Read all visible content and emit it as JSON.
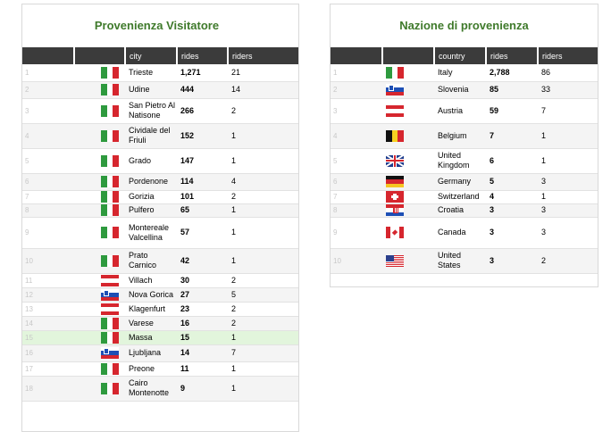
{
  "left": {
    "title": "Provenienza Visitatore",
    "columns": {
      "city": "city",
      "rides": "rides",
      "riders": "riders"
    },
    "rows": [
      {
        "n": "1",
        "flag": "italy-flag-icon",
        "country": "it",
        "city": "Trieste",
        "rides": "1,271",
        "riders": "21"
      },
      {
        "n": "2",
        "flag": "italy-flag-icon",
        "country": "it",
        "city": "Udine",
        "rides": "444",
        "riders": "14"
      },
      {
        "n": "3",
        "flag": "italy-flag-icon",
        "country": "it",
        "city": "San Pietro Al Natisone",
        "rides": "266",
        "riders": "2"
      },
      {
        "n": "4",
        "flag": "italy-flag-icon",
        "country": "it",
        "city": "Cividale del Friuli",
        "rides": "152",
        "riders": "1"
      },
      {
        "n": "5",
        "flag": "italy-flag-icon",
        "country": "it",
        "city": "Grado",
        "rides": "147",
        "riders": "1"
      },
      {
        "n": "6",
        "flag": "italy-flag-icon",
        "country": "it",
        "city": "Pordenone",
        "rides": "114",
        "riders": "4"
      },
      {
        "n": "7",
        "flag": "italy-flag-icon",
        "country": "it",
        "city": "Gorizia",
        "rides": "101",
        "riders": "2"
      },
      {
        "n": "8",
        "flag": "italy-flag-icon",
        "country": "it",
        "city": "Pulfero",
        "rides": "65",
        "riders": "1"
      },
      {
        "n": "9",
        "flag": "italy-flag-icon",
        "country": "it",
        "city": "Montereale Valcellina",
        "rides": "57",
        "riders": "1"
      },
      {
        "n": "10",
        "flag": "italy-flag-icon",
        "country": "it",
        "city": "Prato Carnico",
        "rides": "42",
        "riders": "1"
      },
      {
        "n": "11",
        "flag": "austria-flag-icon",
        "country": "at",
        "city": "Villach",
        "rides": "30",
        "riders": "2"
      },
      {
        "n": "12",
        "flag": "slovenia-flag-icon",
        "country": "si",
        "city": "Nova Gorica",
        "rides": "27",
        "riders": "5"
      },
      {
        "n": "13",
        "flag": "austria-flag-icon",
        "country": "at",
        "city": "Klagenfurt",
        "rides": "23",
        "riders": "2"
      },
      {
        "n": "14",
        "flag": "italy-flag-icon",
        "country": "it",
        "city": "Varese",
        "rides": "16",
        "riders": "2"
      },
      {
        "n": "15",
        "flag": "italy-flag-icon",
        "country": "it",
        "city": "Massa",
        "rides": "15",
        "riders": "1"
      },
      {
        "n": "16",
        "flag": "slovenia-flag-icon",
        "country": "si",
        "city": "Ljubljana",
        "rides": "14",
        "riders": "7"
      },
      {
        "n": "17",
        "flag": "italy-flag-icon",
        "country": "it",
        "city": "Preone",
        "rides": "11",
        "riders": "1"
      },
      {
        "n": "18",
        "flag": "italy-flag-icon",
        "country": "it",
        "city": "Cairo Montenotte",
        "rides": "9",
        "riders": "1"
      }
    ]
  },
  "right": {
    "title": "Nazione di provenienza",
    "columns": {
      "country": "country",
      "rides": "rides",
      "riders": "riders"
    },
    "rows": [
      {
        "n": "1",
        "flag": "italy-flag-icon",
        "country": "it",
        "name": "Italy",
        "rides": "2,788",
        "riders": "86"
      },
      {
        "n": "2",
        "flag": "slovenia-flag-icon",
        "country": "si",
        "name": "Slovenia",
        "rides": "85",
        "riders": "33"
      },
      {
        "n": "3",
        "flag": "austria-flag-icon",
        "country": "at",
        "name": "Austria",
        "rides": "59",
        "riders": "7"
      },
      {
        "n": "4",
        "flag": "belgium-flag-icon",
        "country": "be",
        "name": "Belgium",
        "rides": "7",
        "riders": "1"
      },
      {
        "n": "5",
        "flag": "uk-flag-icon",
        "country": "gb",
        "name": "United Kingdom",
        "rides": "6",
        "riders": "1"
      },
      {
        "n": "6",
        "flag": "germany-flag-icon",
        "country": "de",
        "name": "Germany",
        "rides": "5",
        "riders": "3"
      },
      {
        "n": "7",
        "flag": "switzerland-flag-icon",
        "country": "ch",
        "name": "Switzerland",
        "rides": "4",
        "riders": "1"
      },
      {
        "n": "8",
        "flag": "croatia-flag-icon",
        "country": "hr",
        "name": "Croatia",
        "rides": "3",
        "riders": "3"
      },
      {
        "n": "9",
        "flag": "canada-flag-icon",
        "country": "ca",
        "name": "Canada",
        "rides": "3",
        "riders": "3"
      },
      {
        "n": "10",
        "flag": "usa-flag-icon",
        "country": "us",
        "name": "United States",
        "rides": "3",
        "riders": "2"
      }
    ]
  },
  "colors": {
    "title_green": "#3f7a2b",
    "header_bg": "#3b3b3b",
    "row_alt": "#f4f4f4",
    "row_highlight": "#e2f5dc"
  }
}
